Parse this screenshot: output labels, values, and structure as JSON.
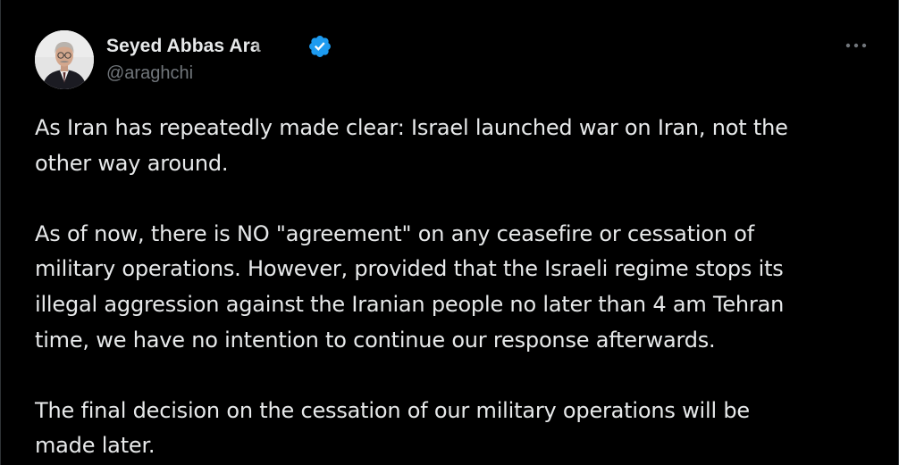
{
  "tweet": {
    "author": {
      "display_name": "Seyed Abbas Ara",
      "handle": "@araghchi",
      "verified": true,
      "avatar_icon": "profile-photo"
    },
    "more_icon": "ellipsis-icon",
    "paragraphs": [
      "As Iran has repeatedly made clear: Israel launched war on Iran, not the\nother way around.",
      "As of now, there is NO \"agreement\" on any ceasefire or cessation of\nmilitary operations. However, provided that the Israeli regime stops its\nillegal aggression against the Iranian people no later than 4 am Tehran\ntime, we have no intention to continue our response afterwards.",
      "The final decision on the cessation of our military operations will be\nmade later."
    ]
  },
  "colors": {
    "background": "#000000",
    "text_primary": "#e7e9ea",
    "text_secondary": "#71767b",
    "verified_blue": "#1d9bf0"
  }
}
